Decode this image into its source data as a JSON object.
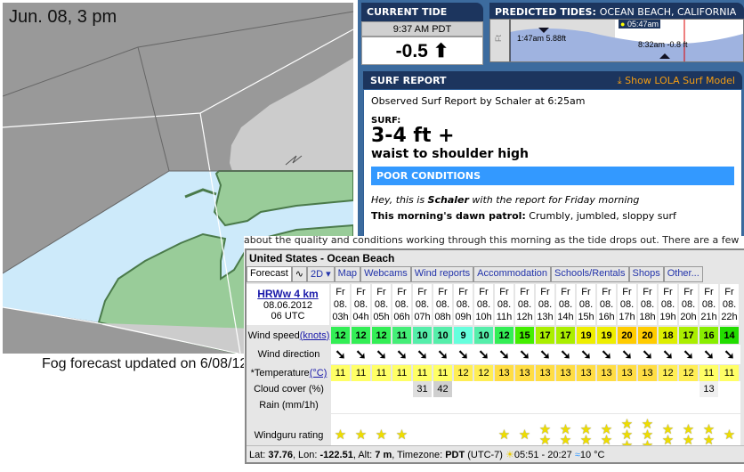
{
  "map": {
    "time_label": "Jun. 08, 3 pm",
    "footer_note": "Fog forecast updated on 6/08/12",
    "colors": {
      "fog": "#999999",
      "land": "#cccccc",
      "water": "#cdeafa",
      "green": "#99cc99"
    }
  },
  "current_tide": {
    "title": "CURRENT TIDE",
    "time": "9:37 AM PDT",
    "value": "-0.5",
    "trend_icon": "arrow-up"
  },
  "predicted_tides": {
    "title_bold": "PREDICTED TIDES:",
    "location": "OCEAN BEACH, CALIFORNIA",
    "axis_label": "Ft",
    "sunrise": "05:47am",
    "high": "1:47am 5.88ft",
    "low": "8:32am -0.8 ft"
  },
  "surf_report": {
    "title": "SURF REPORT",
    "lola_link": "Show LOLA Surf Model",
    "observed": "Observed Surf Report by Schaler at 6:25am",
    "surf_label": "SURF:",
    "height": "3-4 ft +",
    "height_desc": "waist to shoulder high",
    "conditions": "POOR CONDITIONS",
    "conditions_color": "#3399ff",
    "intro_pre": "Hey, this is ",
    "intro_name": "Schaler",
    "intro_post": " with the report for Friday morning",
    "dawn_label": "This morning's dawn patrol:",
    "dawn_text": " Crumbly, jumbled, sloppy surf",
    "overflow_text": "about the quality and conditions working through this morning as the tide drops out. There are a few"
  },
  "forecast": {
    "title": "United States - Ocean Beach",
    "tabs": [
      "Forecast",
      "∿",
      "2D ▾",
      "Map",
      "Webcams",
      "Wind reports",
      "Accommodation",
      "Schools/Rentals",
      "Shops",
      "Other..."
    ],
    "model": "HRWw 4 km",
    "date": "08.06.2012",
    "run": "06 UTC",
    "labels": {
      "wind_speed": "Wind speed ",
      "knots": "(knots)",
      "wind_dir": "Wind direction",
      "temp": "*Temperature ",
      "degc": "(°C)",
      "cloud": "Cloud cover (%)",
      "rain": "Rain (mm/1h)",
      "rating": "Windguru rating"
    },
    "day": "Fr",
    "dom": "08.",
    "hours": [
      "03h",
      "04h",
      "05h",
      "06h",
      "07h",
      "08h",
      "09h",
      "10h",
      "11h",
      "12h",
      "13h",
      "14h",
      "15h",
      "16h",
      "17h",
      "18h",
      "19h",
      "20h",
      "21h",
      "22h"
    ],
    "wind_speed": [
      12,
      12,
      12,
      11,
      10,
      10,
      9,
      10,
      12,
      15,
      17,
      17,
      19,
      19,
      20,
      20,
      18,
      17,
      16,
      14
    ],
    "temperature": [
      11,
      11,
      11,
      11,
      11,
      11,
      12,
      12,
      13,
      13,
      13,
      13,
      13,
      13,
      13,
      13,
      12,
      12,
      11,
      11
    ],
    "cloud": [
      "",
      "",
      "",
      "",
      "31",
      "42",
      "",
      "",
      "",
      "",
      "",
      "",
      "",
      "",
      "",
      "",
      "",
      "",
      "13",
      ""
    ],
    "rating": [
      1,
      1,
      1,
      1,
      0,
      0,
      0,
      0,
      1,
      1,
      2,
      2,
      2,
      2,
      3,
      3,
      2,
      2,
      2,
      1
    ],
    "footer": {
      "lat_label": "Lat: ",
      "lat": "37.76",
      "lon_label": ", Lon: ",
      "lon": "-122.51",
      "alt_label": ", Alt: ",
      "alt": "7 m",
      "tz_label": ", Timezone: ",
      "tz": "PDT",
      "utc": " (UTC-7)",
      "sun": "05:51 - 20:27",
      "water": "10 °C"
    }
  }
}
